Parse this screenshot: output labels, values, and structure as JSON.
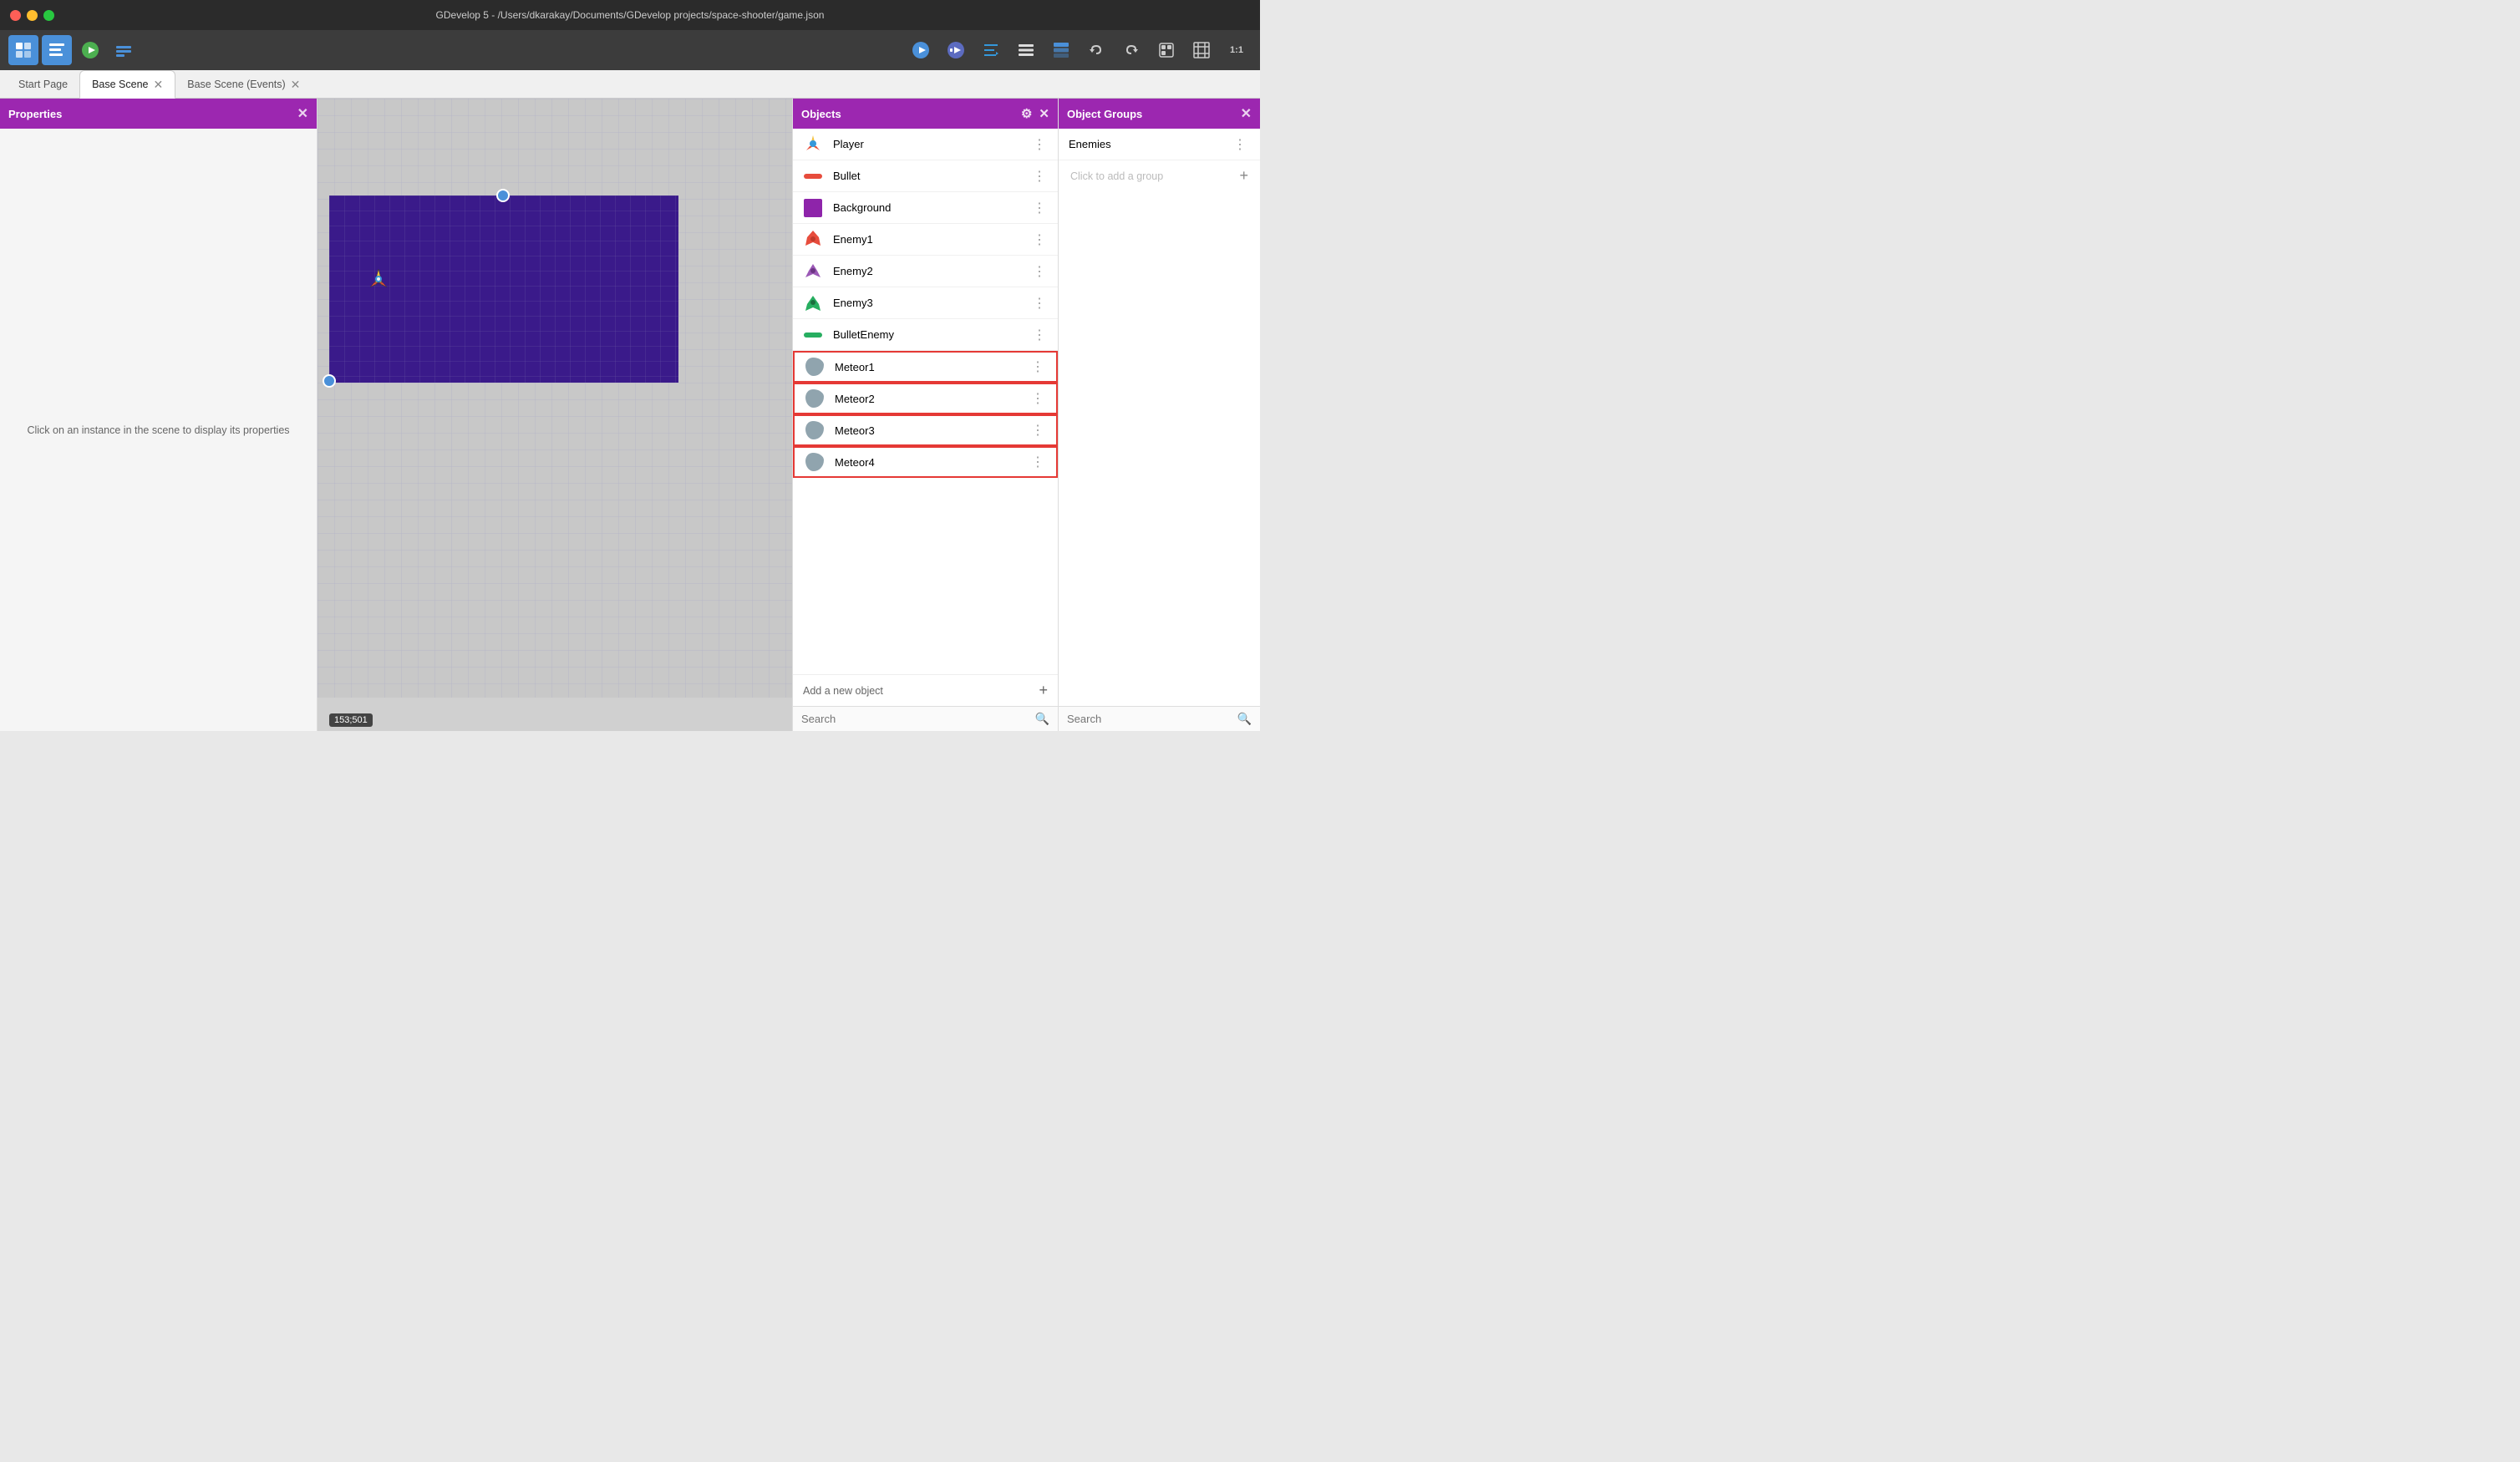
{
  "titlebar": {
    "title": "GDevelop 5 - /Users/dkarakay/Documents/GDevelop projects/space-shooter/game.json"
  },
  "toolbar": {
    "left_buttons": [
      {
        "name": "scene-editor-icon",
        "label": "≡",
        "active": true
      },
      {
        "name": "events-editor-icon",
        "label": "⊞"
      },
      {
        "name": "play-icon",
        "label": "▶"
      },
      {
        "name": "build-icon",
        "label": "⚙"
      }
    ],
    "right_buttons": [
      {
        "name": "preview-icon",
        "label": "🔵"
      },
      {
        "name": "preview-debug-icon",
        "label": "🔷"
      },
      {
        "name": "edit-icon",
        "label": "✏"
      },
      {
        "name": "list-icon",
        "label": "≡"
      },
      {
        "name": "layers-icon",
        "label": "⧉"
      },
      {
        "name": "undo-icon",
        "label": "↩"
      },
      {
        "name": "redo-icon",
        "label": "↪"
      },
      {
        "name": "export-icon",
        "label": "📋"
      },
      {
        "name": "grid-icon",
        "label": "⊞"
      },
      {
        "name": "zoom-icon",
        "label": "1:1"
      }
    ]
  },
  "tabs": [
    {
      "label": "Start Page",
      "active": false,
      "closeable": false
    },
    {
      "label": "Base Scene",
      "active": true,
      "closeable": true
    },
    {
      "label": "Base Scene (Events)",
      "active": false,
      "closeable": true
    }
  ],
  "properties_panel": {
    "title": "Properties",
    "hint_text": "Click on an instance in the scene to display its properties"
  },
  "scene": {
    "coords": "153;501"
  },
  "objects_panel": {
    "title": "Objects",
    "items": [
      {
        "name": "Player",
        "icon_type": "player"
      },
      {
        "name": "Bullet",
        "icon_type": "bullet"
      },
      {
        "name": "Background",
        "icon_type": "background"
      },
      {
        "name": "Enemy1",
        "icon_type": "enemy"
      },
      {
        "name": "Enemy2",
        "icon_type": "enemy"
      },
      {
        "name": "Enemy3",
        "icon_type": "enemy"
      },
      {
        "name": "BulletEnemy",
        "icon_type": "bullet"
      },
      {
        "name": "Meteor1",
        "icon_type": "meteor",
        "in_group": true
      },
      {
        "name": "Meteor2",
        "icon_type": "meteor",
        "in_group": true
      },
      {
        "name": "Meteor3",
        "icon_type": "meteor",
        "in_group": true
      },
      {
        "name": "Meteor4",
        "icon_type": "meteor",
        "in_group": true
      }
    ],
    "add_label": "Add a new object",
    "search_placeholder": "Search"
  },
  "groups_panel": {
    "title": "Object Groups",
    "groups": [
      {
        "name": "Enemies"
      }
    ],
    "add_group_label": "Click to add a group",
    "search_placeholder": "Search"
  }
}
